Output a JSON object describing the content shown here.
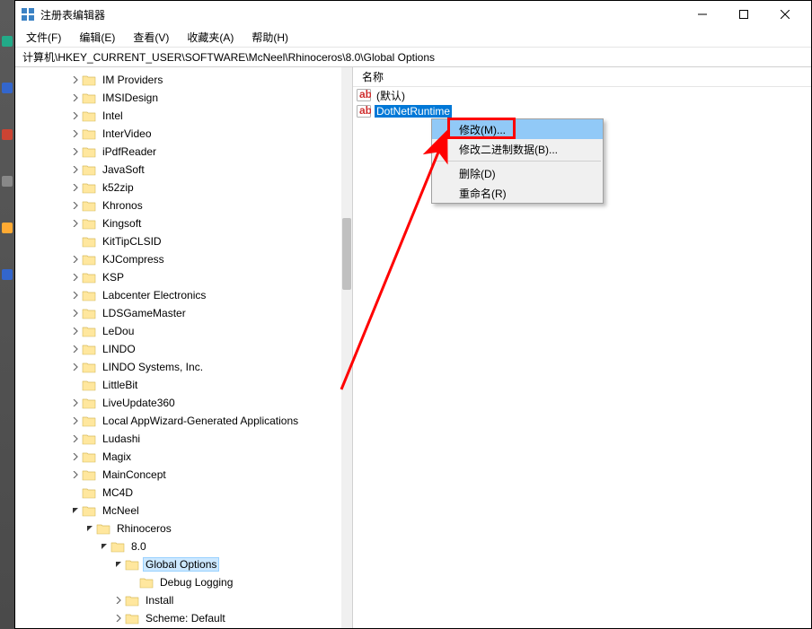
{
  "window": {
    "title": "注册表编辑器"
  },
  "menu": {
    "file": "文件(F)",
    "edit": "编辑(E)",
    "view": "查看(V)",
    "favorites": "收藏夹(A)",
    "help": "帮助(H)"
  },
  "address": {
    "path": "计算机\\HKEY_CURRENT_USER\\SOFTWARE\\McNeel\\Rhinoceros\\8.0\\Global Options"
  },
  "tree": {
    "items": [
      {
        "indent": 3,
        "expander": "closed",
        "label": "IM Providers"
      },
      {
        "indent": 3,
        "expander": "closed",
        "label": "IMSIDesign"
      },
      {
        "indent": 3,
        "expander": "closed",
        "label": "Intel"
      },
      {
        "indent": 3,
        "expander": "closed",
        "label": "InterVideo"
      },
      {
        "indent": 3,
        "expander": "closed",
        "label": "iPdfReader"
      },
      {
        "indent": 3,
        "expander": "closed",
        "label": "JavaSoft"
      },
      {
        "indent": 3,
        "expander": "closed",
        "label": "k52zip"
      },
      {
        "indent": 3,
        "expander": "closed",
        "label": "Khronos"
      },
      {
        "indent": 3,
        "expander": "closed",
        "label": "Kingsoft"
      },
      {
        "indent": 3,
        "expander": "none",
        "label": "KitTipCLSID"
      },
      {
        "indent": 3,
        "expander": "closed",
        "label": "KJCompress"
      },
      {
        "indent": 3,
        "expander": "closed",
        "label": "KSP"
      },
      {
        "indent": 3,
        "expander": "closed",
        "label": "Labcenter Electronics"
      },
      {
        "indent": 3,
        "expander": "closed",
        "label": "LDSGameMaster"
      },
      {
        "indent": 3,
        "expander": "closed",
        "label": "LeDou"
      },
      {
        "indent": 3,
        "expander": "closed",
        "label": "LINDO"
      },
      {
        "indent": 3,
        "expander": "closed",
        "label": "LINDO Systems, Inc."
      },
      {
        "indent": 3,
        "expander": "none",
        "label": "LittleBit"
      },
      {
        "indent": 3,
        "expander": "closed",
        "label": "LiveUpdate360"
      },
      {
        "indent": 3,
        "expander": "closed",
        "label": "Local AppWizard-Generated Applications"
      },
      {
        "indent": 3,
        "expander": "closed",
        "label": "Ludashi"
      },
      {
        "indent": 3,
        "expander": "closed",
        "label": "Magix"
      },
      {
        "indent": 3,
        "expander": "closed",
        "label": "MainConcept"
      },
      {
        "indent": 3,
        "expander": "none",
        "label": "MC4D"
      },
      {
        "indent": 3,
        "expander": "open",
        "label": "McNeel"
      },
      {
        "indent": 4,
        "expander": "open",
        "label": "Rhinoceros"
      },
      {
        "indent": 5,
        "expander": "open",
        "label": "8.0"
      },
      {
        "indent": 6,
        "expander": "open",
        "label": "Global Options",
        "selected": true
      },
      {
        "indent": 7,
        "expander": "none",
        "label": "Debug Logging"
      },
      {
        "indent": 6,
        "expander": "closed",
        "label": "Install"
      },
      {
        "indent": 6,
        "expander": "closed",
        "label": "Scheme: Default"
      }
    ]
  },
  "list": {
    "header": {
      "name": "名称"
    },
    "rows": [
      {
        "type": "string",
        "label": "(默认)",
        "selected": false
      },
      {
        "type": "string",
        "label": "DotNetRuntime",
        "selected": true
      }
    ]
  },
  "contextMenu": {
    "items": [
      {
        "label": "修改(M)...",
        "highlighted": true
      },
      {
        "label": "修改二进制数据(B)..."
      },
      {
        "sep": true
      },
      {
        "label": "删除(D)"
      },
      {
        "label": "重命名(R)"
      }
    ]
  }
}
